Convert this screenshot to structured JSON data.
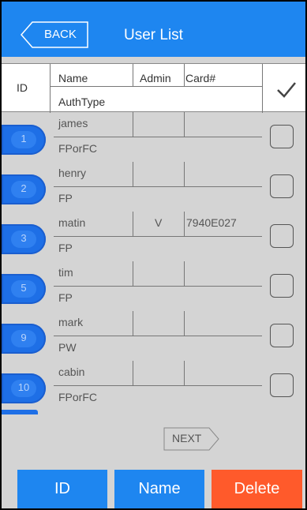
{
  "header": {
    "back_label": "BACK",
    "title": "User List"
  },
  "columns": {
    "id": "ID",
    "name": "Name",
    "admin": "Admin",
    "card": "Card#",
    "authtype": "AuthType"
  },
  "rows": [
    {
      "id": "1",
      "name": "james",
      "admin": "",
      "card": "",
      "auth": "FPorFC",
      "checked": false
    },
    {
      "id": "2",
      "name": "henry",
      "admin": "",
      "card": "",
      "auth": "FP",
      "checked": false
    },
    {
      "id": "3",
      "name": "matin",
      "admin": "V",
      "card": "7940E027",
      "auth": "FP",
      "checked": false
    },
    {
      "id": "5",
      "name": "tim",
      "admin": "",
      "card": "",
      "auth": "FP",
      "checked": false
    },
    {
      "id": "9",
      "name": "mark",
      "admin": "",
      "card": "",
      "auth": "PW",
      "checked": false
    },
    {
      "id": "10",
      "name": "cabin",
      "admin": "",
      "card": "",
      "auth": "FPorFC",
      "checked": false
    }
  ],
  "pager": {
    "next_label": "NEXT"
  },
  "buttons": {
    "id_label": "ID",
    "name_label": "Name",
    "delete_label": "Delete"
  },
  "colors": {
    "header": "#1e86f0",
    "pill": "#1e6fe6",
    "delete": "#ff5a2b",
    "background": "#d4d4d4"
  },
  "icons": {
    "back": "back-arrow-icon",
    "select_all": "checkmark-icon",
    "next": "chevron-right-icon"
  }
}
